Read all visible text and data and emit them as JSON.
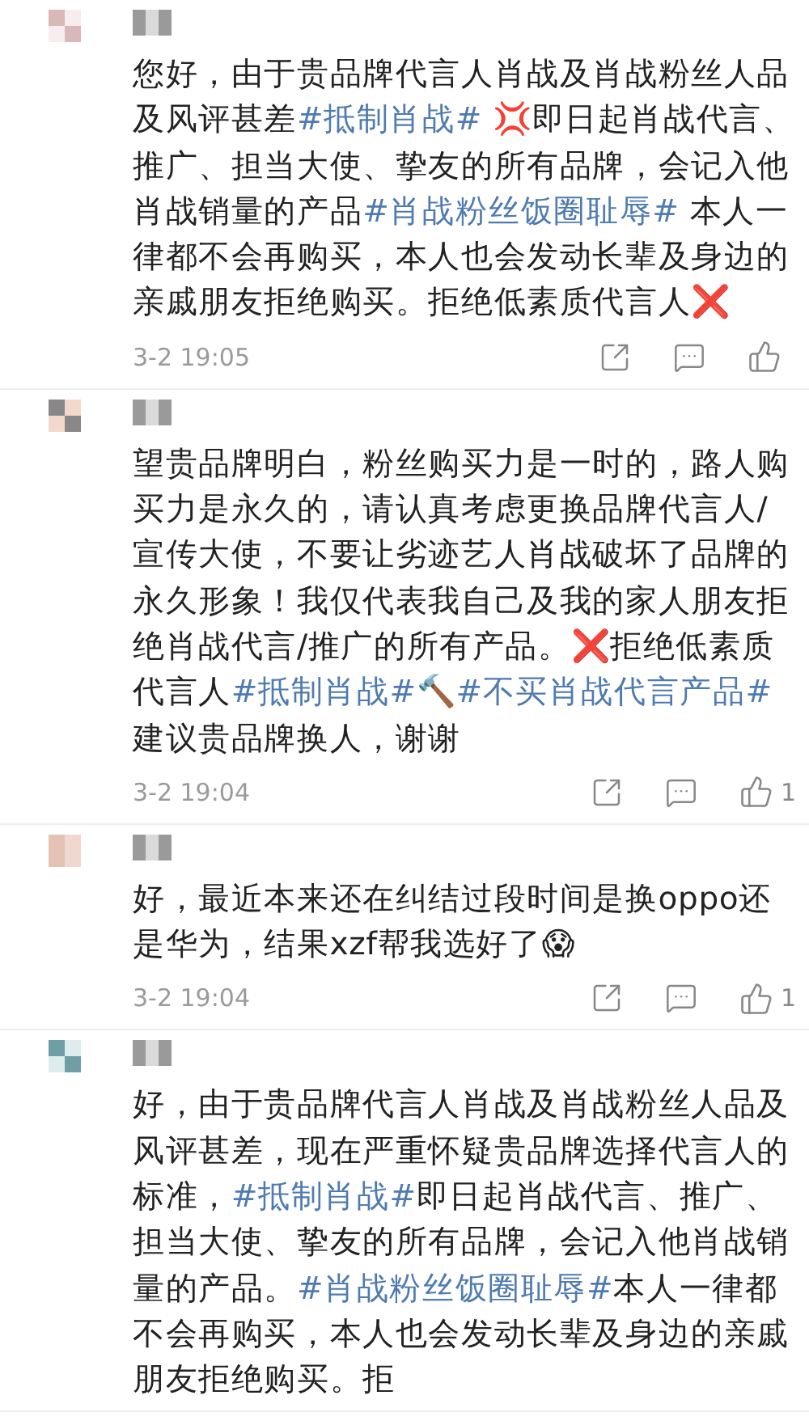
{
  "comments": [
    {
      "segments": [
        {
          "kind": "plain",
          "text": "您好，由于贵品牌代言人肖战及肖战粉丝人品及风评甚差"
        },
        {
          "kind": "tag",
          "text": "#抵制肖战#"
        },
        {
          "kind": "plain",
          "text": " 💢即日起肖战代言、推广、担当大使、挚友的所有品牌，会记入他肖战销量的产品"
        },
        {
          "kind": "tag",
          "text": "#肖战粉丝饭圈耻辱#"
        },
        {
          "kind": "plain",
          "text": " 本人一律都不会再购买，本人也会发动长辈及身边的亲戚朋友拒绝购买。拒绝低素质代言人❌"
        }
      ],
      "time": "3-2 19:05"
    },
    {
      "segments": [
        {
          "kind": "plain",
          "text": "望贵品牌明白，粉丝购买力是一时的，路人购买力是永久的，请认真考虑更换品牌代言人/宣传大使，不要让劣迹艺人肖战破坏了品牌的永久形象！我仅代表我自己及我的家人朋友拒绝肖战代言/推广的所有产品。❌拒绝低素质代言人"
        },
        {
          "kind": "tag",
          "text": "#抵制肖战#"
        },
        {
          "kind": "plain",
          "text": "🔨"
        },
        {
          "kind": "tag",
          "text": "#不买肖战代言产品#"
        },
        {
          "kind": "plain",
          "text": "建议贵品牌换人，谢谢"
        }
      ],
      "time": "3-2 19:04",
      "likes": "1"
    },
    {
      "segments": [
        {
          "kind": "plain",
          "text": "好，最近本来还在纠结过段时间是换oppo还是华为，结果xzf帮我选好了😱"
        }
      ],
      "time": "3-2 19:04",
      "likes": "1"
    },
    {
      "segments": [
        {
          "kind": "plain",
          "text": "好，由于贵品牌代言人肖战及肖战粉丝人品及风评甚差，现在严重怀疑贵品牌选择代言人的标准，"
        },
        {
          "kind": "tag",
          "text": "#抵制肖战#"
        },
        {
          "kind": "plain",
          "text": "即日起肖战代言、推广、担当大使、挚友的所有品牌，会记入他肖战销量的产品。"
        },
        {
          "kind": "tag",
          "text": "#肖战粉丝饭圈耻辱#"
        },
        {
          "kind": "plain",
          "text": "本人一律都不会再购买，本人也会发动长辈及身边的亲戚朋友拒绝购买。拒"
        }
      ]
    }
  ]
}
